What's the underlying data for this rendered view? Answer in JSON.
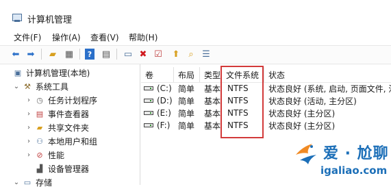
{
  "window": {
    "title": "计算机管理"
  },
  "menu": [
    "文件(F)",
    "操作(A)",
    "查看(V)",
    "帮助(H)"
  ],
  "toolbar_icons": [
    "back-arrow-icon",
    "forward-arrow-icon",
    "up-folder-icon",
    "show-hide-tree-icon",
    "help-icon",
    "console-icon",
    "connect-icon",
    "delete-icon",
    "properties-icon",
    "export-icon",
    "find-icon",
    "list-icon"
  ],
  "tree": [
    {
      "label": "计算机管理(本地)",
      "icon": "computer-mgmt-icon",
      "chevron": ""
    },
    {
      "label": "系统工具",
      "icon": "tools-icon",
      "chevron": "⌄"
    },
    {
      "label": "任务计划程序",
      "icon": "clock-icon",
      "chevron": "›"
    },
    {
      "label": "事件查看器",
      "icon": "event-viewer-icon",
      "chevron": "›"
    },
    {
      "label": "共享文件夹",
      "icon": "shared-folder-icon",
      "chevron": "›"
    },
    {
      "label": "本地用户和组",
      "icon": "users-icon",
      "chevron": "›"
    },
    {
      "label": "性能",
      "icon": "performance-icon",
      "chevron": "›"
    },
    {
      "label": "设备管理器",
      "icon": "device-manager-icon",
      "chevron": ""
    },
    {
      "label": "存储",
      "icon": "storage-icon",
      "chevron": "⌄"
    }
  ],
  "table": {
    "headers": [
      "卷",
      "布局",
      "类型",
      "文件系统",
      "状态"
    ],
    "rows": [
      {
        "volume": "(C:)",
        "layout": "简单",
        "type": "基本",
        "fs": "NTFS",
        "status": "状态良好 (系统, 启动, 页面文件, 活"
      },
      {
        "volume": "(D:)",
        "layout": "简单",
        "type": "基本",
        "fs": "NTFS",
        "status": "状态良好 (活动, 主分区)"
      },
      {
        "volume": "(E:)",
        "layout": "简单",
        "type": "基本",
        "fs": "NTFS",
        "status": "状态良好 (主分区)"
      },
      {
        "volume": "(F:)",
        "layout": "简单",
        "type": "基本",
        "fs": "NTFS",
        "status": "状态良好 (主分区)"
      }
    ]
  },
  "watermark": {
    "brand": "爱 · 尬聊",
    "url": "igaliao.com"
  },
  "colors": {
    "highlight": "#d23a3a",
    "brand": "#1c6fb8",
    "accent_orange": "#f08a24"
  }
}
